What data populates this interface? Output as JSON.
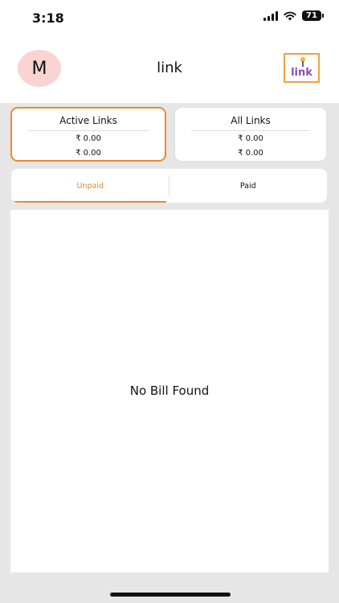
{
  "status_bar": {
    "time": "3:18",
    "battery": "71"
  },
  "header": {
    "avatar_letter": "M",
    "title": "link",
    "logo_text": "link"
  },
  "cards": {
    "active": {
      "title": "Active Links",
      "value1": "₹ 0.00",
      "value2": "₹ 0.00"
    },
    "all": {
      "title": "All Links",
      "value1": "₹ 0.00",
      "value2": "₹ 0.00"
    }
  },
  "tabs": {
    "unpaid": "Unpaid",
    "paid": "Paid"
  },
  "content": {
    "empty_message": "No Bill Found"
  },
  "colors": {
    "accent": "#f0892a",
    "avatar_bg": "#f9d4d2",
    "logo_text": "#8a4fb0"
  }
}
